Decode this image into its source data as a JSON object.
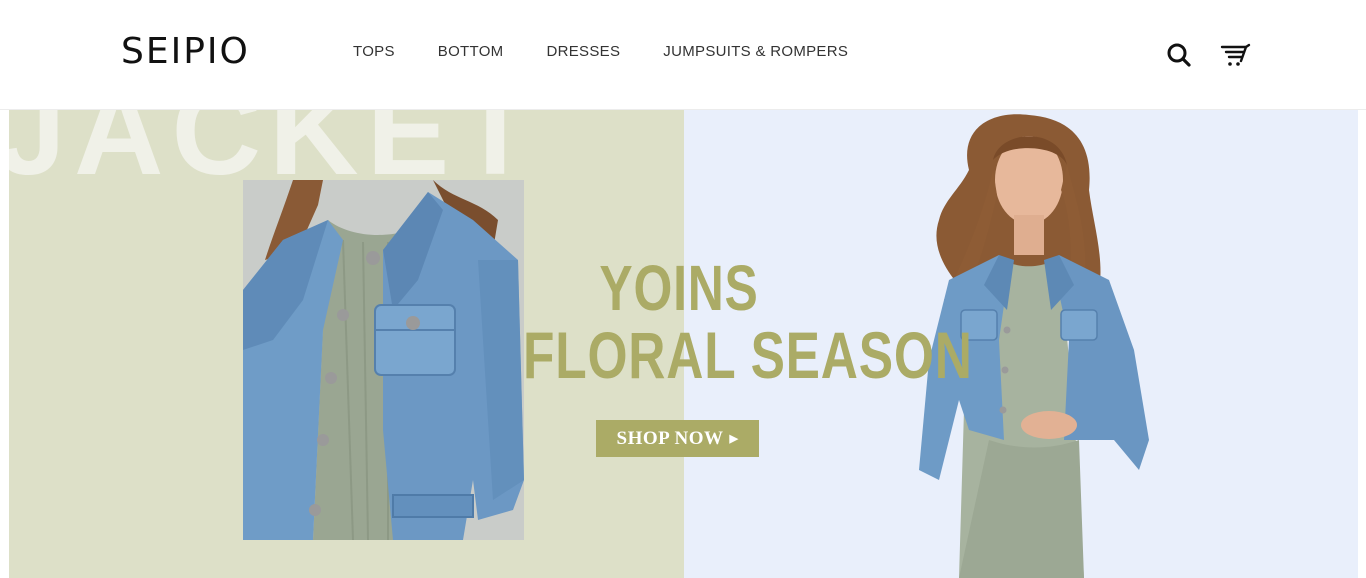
{
  "header": {
    "logo": "SEIPIO",
    "nav": [
      {
        "label": "TOPS"
      },
      {
        "label": "BOTTOM"
      },
      {
        "label": "DRESSES"
      },
      {
        "label": "JUMPSUITS & ROMPERS"
      }
    ],
    "icons": {
      "search": "search-icon",
      "cart": "cart-icon"
    }
  },
  "banner": {
    "bg_word": "JACKET",
    "headline_line1": "YOINS",
    "headline_line2": "FLORAL  SEASON",
    "cta_label": "SHOP NOW",
    "cta_arrow": "▶",
    "colors": {
      "left_bg": "#dde0c8",
      "right_bg": "#e9effb",
      "accent": "#abab66",
      "denim": "#6f9cc7"
    }
  }
}
